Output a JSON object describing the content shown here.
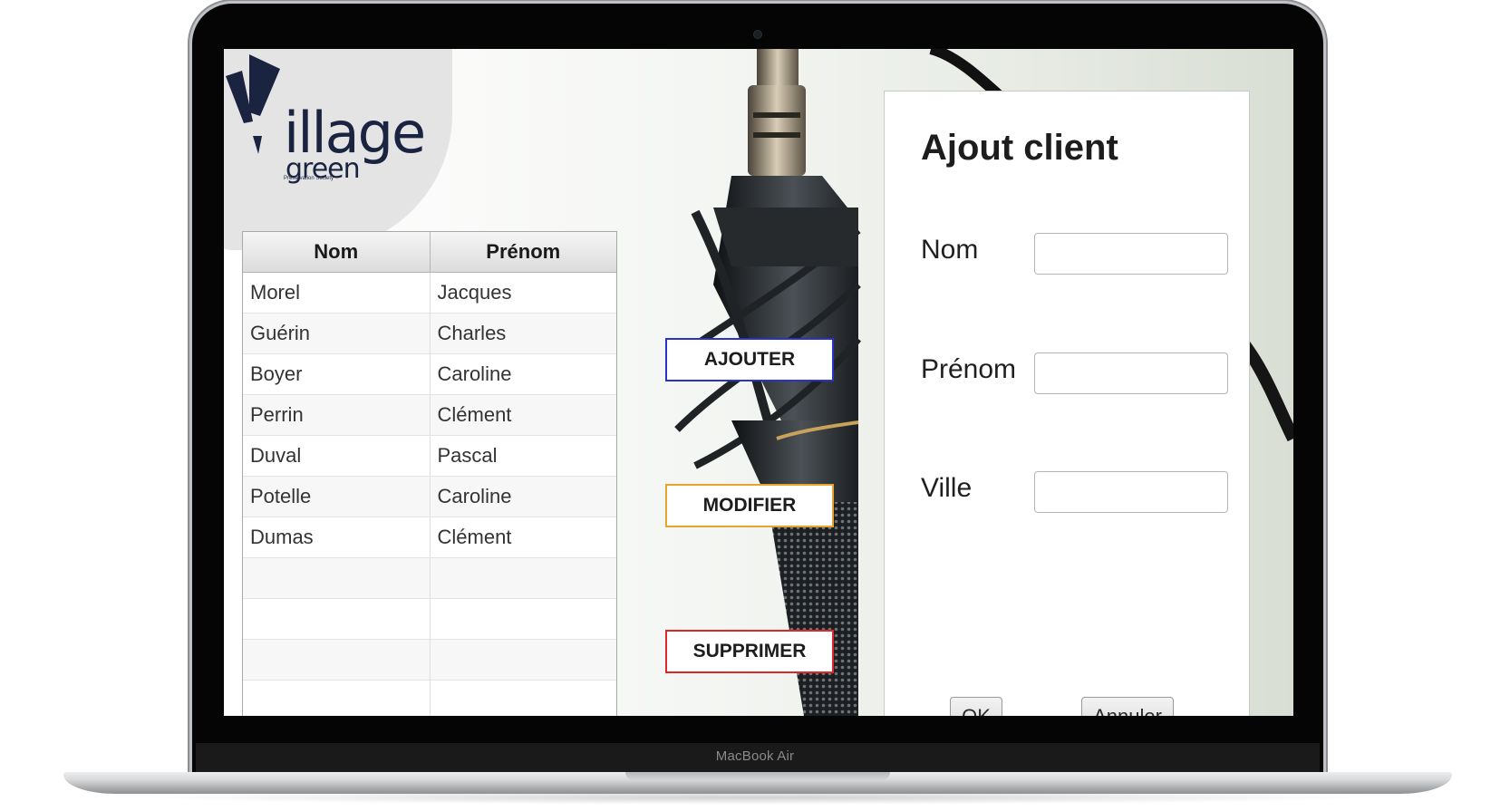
{
  "device": {
    "label": "MacBook Air"
  },
  "logo": {
    "word": "illage",
    "sub": "green",
    "tagline": "Preservation Society"
  },
  "table": {
    "headers": [
      "Nom",
      "Prénom"
    ],
    "rows": [
      [
        "Morel",
        "Jacques"
      ],
      [
        "Guérin",
        "Charles"
      ],
      [
        "Boyer",
        "Caroline"
      ],
      [
        "Perrin",
        "Clément"
      ],
      [
        "Duval",
        "Pascal"
      ],
      [
        "Potelle",
        "Caroline"
      ],
      [
        "Dumas",
        "Clément"
      ],
      [
        "",
        ""
      ],
      [
        "",
        ""
      ],
      [
        "",
        ""
      ],
      [
        "",
        ""
      ]
    ]
  },
  "actions": {
    "add": "AJOUTER",
    "edit": "MODIFIER",
    "delete": "SUPPRIMER"
  },
  "form": {
    "title": "Ajout client",
    "fields": [
      {
        "label": "Nom",
        "value": ""
      },
      {
        "label": "Prénom",
        "value": ""
      },
      {
        "label": "Ville",
        "value": ""
      }
    ],
    "ok": "OK",
    "cancel": "Annuler"
  },
  "colors": {
    "add_border": "#2a33c9",
    "edit_border": "#e8a52d",
    "delete_border": "#e0262d",
    "logo": "#1a2340"
  }
}
